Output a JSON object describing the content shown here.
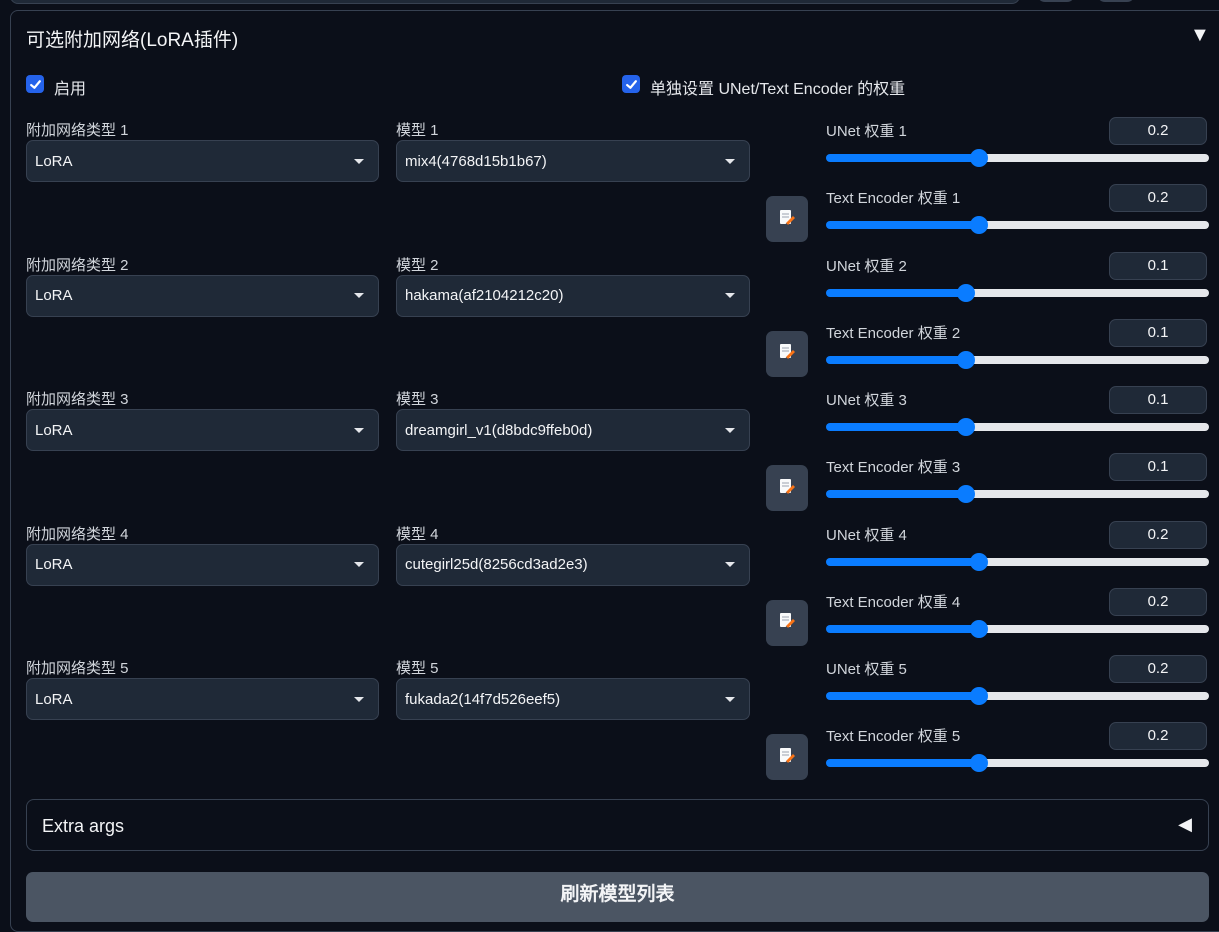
{
  "panel": {
    "title": "可选附加网络(LoRA插件)",
    "collapse_icon": "triangle-down-icon",
    "enable_label": "启用",
    "enable_checked": true,
    "separate_weights_label": "单独设置 UNet/Text Encoder 的权重",
    "separate_weights_checked": true
  },
  "rows": [
    {
      "type_label": "附加网络类型 1",
      "type_value": "LoRA",
      "model_label": "模型 1",
      "model_value": "mix4(4768d15b1b67)",
      "unet_label": "UNet 权重 1",
      "unet_value": "0.2",
      "te_label": "Text Encoder 权重 1",
      "te_value": "0.2"
    },
    {
      "type_label": "附加网络类型 2",
      "type_value": "LoRA",
      "model_label": "模型 2",
      "model_value": "hakama(af2104212c20)",
      "unet_label": "UNet 权重 2",
      "unet_value": "0.1",
      "te_label": "Text Encoder 权重 2",
      "te_value": "0.1"
    },
    {
      "type_label": "附加网络类型 3",
      "type_value": "LoRA",
      "model_label": "模型 3",
      "model_value": "dreamgirl_v1(d8bdc9ffeb0d)",
      "unet_label": "UNet 权重 3",
      "unet_value": "0.1",
      "te_label": "Text Encoder 权重 3",
      "te_value": "0.1"
    },
    {
      "type_label": "附加网络类型 4",
      "type_value": "LoRA",
      "model_label": "模型 4",
      "model_value": "cutegirl25d(8256cd3ad2e3)",
      "unet_label": "UNet 权重 4",
      "unet_value": "0.2",
      "te_label": "Text Encoder 权重 4",
      "te_value": "0.2"
    },
    {
      "type_label": "附加网络类型 5",
      "type_value": "LoRA",
      "model_label": "模型 5",
      "model_value": "fukada2(14f7d526eef5)",
      "unet_label": "UNet 权重 5",
      "unet_value": "0.2",
      "te_label": "Text Encoder 权重 5",
      "te_value": "0.2"
    }
  ],
  "slider_range": [
    -1,
    2
  ],
  "extra_args": {
    "label": "Extra args",
    "icon": "triangle-left-icon"
  },
  "refresh_button": {
    "label": "刷新模型列表"
  },
  "colors": {
    "accent": "#0a7cff",
    "checkbox": "#2563eb",
    "background": "#0b0f19",
    "input_bg": "#1f2937",
    "track_rest": "#e5e7eb"
  }
}
